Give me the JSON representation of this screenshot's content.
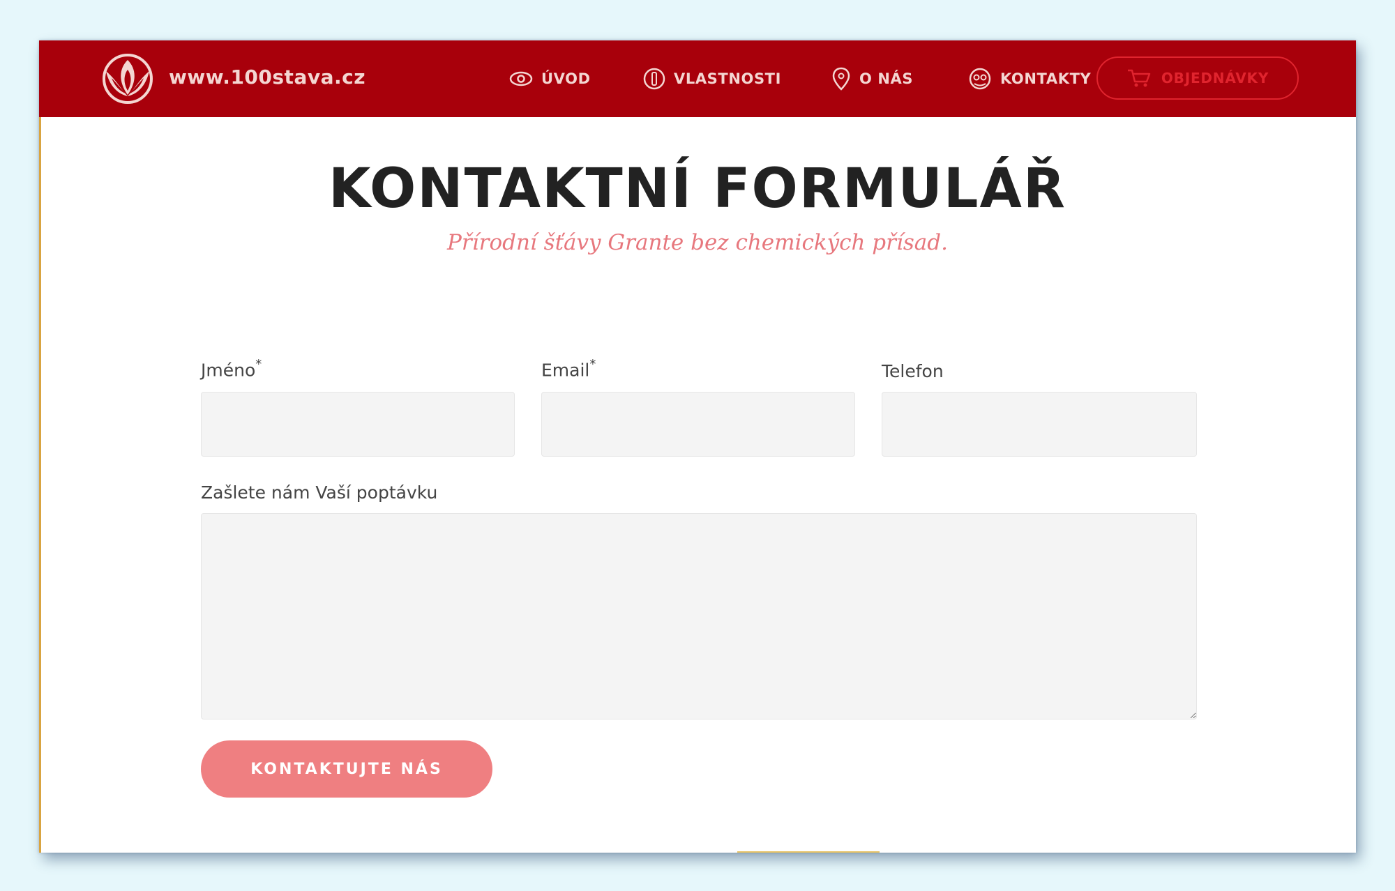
{
  "header": {
    "site_name": "www.100stava.cz",
    "nav": [
      {
        "label": "ÚVOD",
        "icon": "eye-icon"
      },
      {
        "label": "VLASTNOSTI",
        "icon": "bottle-icon"
      },
      {
        "label": "O NÁS",
        "icon": "location-pin-icon"
      },
      {
        "label": "KONTAKTY",
        "icon": "contact-icon"
      }
    ],
    "order_button": {
      "label": "OBJEDNÁVKY",
      "icon": "cart-icon"
    }
  },
  "page": {
    "title": "KONTAKTNÍ FORMULÁŘ",
    "subtitle": "Přírodní šťávy Grante bez chemických přísad."
  },
  "form": {
    "name": {
      "label": "Jméno",
      "required_mark": "*",
      "value": ""
    },
    "email": {
      "label": "Email",
      "required_mark": "*",
      "value": ""
    },
    "phone": {
      "label": "Telefon",
      "value": ""
    },
    "message": {
      "label": "Zašlete nám Vaší poptávku",
      "value": ""
    },
    "submit_label": "KONTAKTUJTE NÁS"
  },
  "colors": {
    "header_bg": "#a8000b",
    "nav_text": "#f4d6d2",
    "order_accent": "#e0242e",
    "subtitle": "#e7777d",
    "button_bg": "#ef7f81"
  }
}
